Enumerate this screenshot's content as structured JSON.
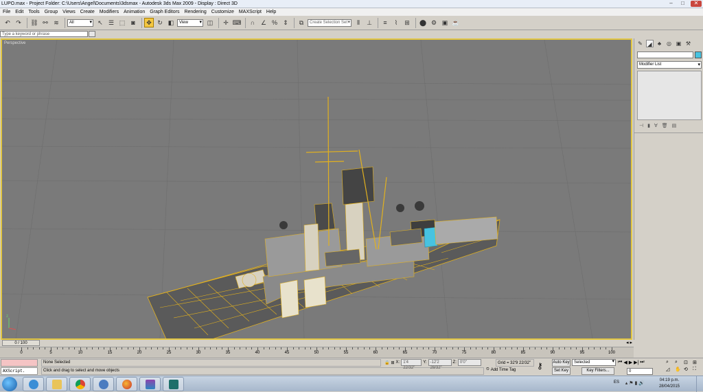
{
  "titlebar": {
    "title": "LUPO.max    - Project Folder: C:\\Users\\Angel\\Documents\\3dsmax      - Autodesk 3ds Max  2009       - Display : Direct 3D"
  },
  "menu": [
    "File",
    "Edit",
    "Tools",
    "Group",
    "Views",
    "Create",
    "Modifiers",
    "Animation",
    "Graph Editors",
    "Rendering",
    "Customize",
    "MAXScript",
    "Help"
  ],
  "toolbar": {
    "filter_value": "All",
    "refcoord_value": "View",
    "named_selection_placeholder": "Create Selection Set"
  },
  "search": {
    "placeholder": "Type a keyword or phrase"
  },
  "viewport": {
    "label": "Perspective"
  },
  "command_panel": {
    "modifier_list": "Modifier List"
  },
  "time_slider": {
    "position": "0 / 100",
    "current_frame": 0,
    "total_frames": 100
  },
  "trackbar": {
    "labels": [
      "0",
      "5",
      "10",
      "15",
      "20",
      "25",
      "30",
      "35",
      "40",
      "45",
      "50",
      "55",
      "60",
      "65",
      "70",
      "75",
      "80",
      "85",
      "90",
      "95",
      "100"
    ]
  },
  "status": {
    "maxscript": "AXScript.",
    "selection": "None Selected",
    "prompt": "Click and drag to select and move objects",
    "x_label": "X:",
    "x_value": "1'4 22/32\"",
    "y_label": "Y:",
    "y_value": "-12'2 28/32\"",
    "z_label": "Z:",
    "z_value": "0'0\"",
    "grid": "Grid = 32'9 22/32\"",
    "add_time_tag": "Add Time Tag",
    "auto_key": "Auto Key",
    "set_key": "Set Key",
    "selected_option": "Selected",
    "key_filters": "Key Filters...",
    "frame_value": "0"
  },
  "taskbar": {
    "language": "ES",
    "time": "04:19 p.m.",
    "date": "28/04/2015",
    "apps": [
      "windows-explorer",
      "internet-explorer",
      "file-explorer",
      "chrome",
      "app-circle",
      "firefox",
      "winrar",
      "3ds-max"
    ]
  },
  "colors": {
    "viewport_bg": "#7a7a7a",
    "wireframe": "#e2b11f",
    "active_border": "#e2c642",
    "selection_swatch": "#47c3e0"
  }
}
